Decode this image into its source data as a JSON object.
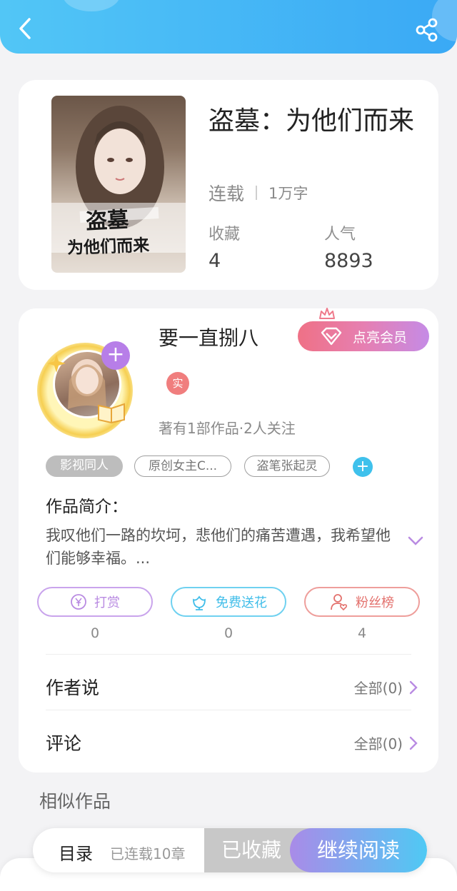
{
  "book": {
    "title": "盗墓：为他们而来",
    "status": "连载",
    "word_count": "1万字",
    "stats": [
      {
        "label": "收藏",
        "value": "4"
      },
      {
        "label": "人气",
        "value": "8893"
      }
    ],
    "cover_text": {
      "line1": "盗墓",
      "line2": "为他们而来"
    }
  },
  "author": {
    "name": "要一直捌八",
    "vip_label": "点亮会员",
    "real_badge": "实",
    "stats_text": "著有1部作品·2人关注",
    "add_label": "+"
  },
  "tags": [
    "影视同人",
    "原创女主C...",
    "盗笔张起灵"
  ],
  "tag_add": "+",
  "intro": {
    "label": "作品简介：",
    "text": "我叹他们一路的坎坷，悲他们的痛苦遭遇，我希望他们能够幸福。..."
  },
  "actions": [
    {
      "label": "打赏",
      "count": "0",
      "color": "#b98be2",
      "icon": "yen-coin-icon"
    },
    {
      "label": "免费送花",
      "count": "0",
      "color": "#4ec3ea",
      "icon": "flower-icon"
    },
    {
      "label": "粉丝榜",
      "count": "4",
      "color": "#e88885",
      "icon": "fan-user-icon"
    }
  ],
  "rows": [
    {
      "label": "作者说",
      "right": "全部(0)"
    },
    {
      "label": "评论",
      "right": "全部(0)"
    }
  ],
  "similar_title": "相似作品",
  "bottom_bar": {
    "toc": "目录",
    "serial": "已连载10章",
    "collected": "已收藏",
    "continue": "继续阅读"
  },
  "colors": {
    "header_start": "#52c6f6",
    "header_end": "#3aa9f5",
    "vip_gradient_start": "#ef7186",
    "vip_gradient_end": "#c58be6",
    "accent_purple": "#b77ee8",
    "continue_start": "#a98be8",
    "continue_end": "#4fc9f4"
  }
}
